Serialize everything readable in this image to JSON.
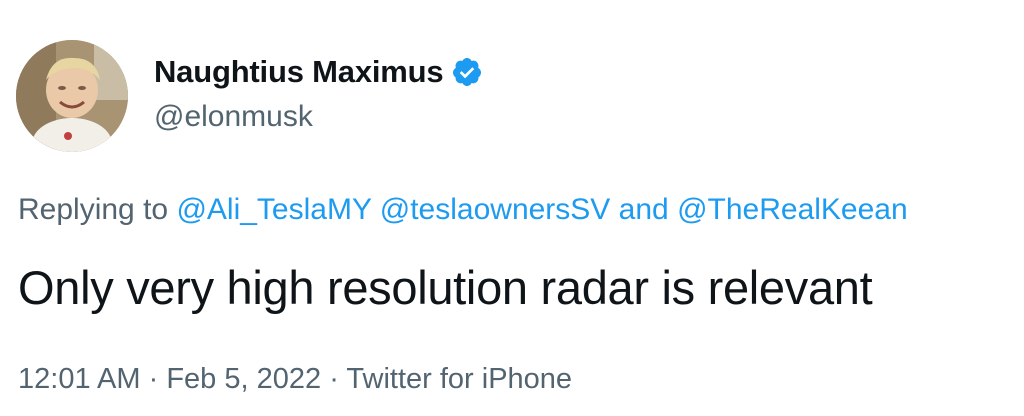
{
  "author": {
    "display_name": "Naughtius Maximus",
    "handle": "@elonmusk",
    "verified": true,
    "avatar_icon": "child-photo-avatar"
  },
  "reply": {
    "prefix": "Replying to",
    "mention_1": "@Ali_TeslaMY",
    "mention_2": "@teslaownersSV",
    "conjunction": "and",
    "mention_3": "@TheRealKeean"
  },
  "tweet": {
    "text": "Only very high resolution radar is relevant"
  },
  "meta": {
    "time": "12:01 AM",
    "separator_1": "·",
    "date": "Feb 5, 2022",
    "separator_2": "·",
    "source": "Twitter for iPhone"
  },
  "colors": {
    "accent": "#1d9bf0",
    "text_primary": "#0f1419",
    "text_secondary": "#536471"
  }
}
